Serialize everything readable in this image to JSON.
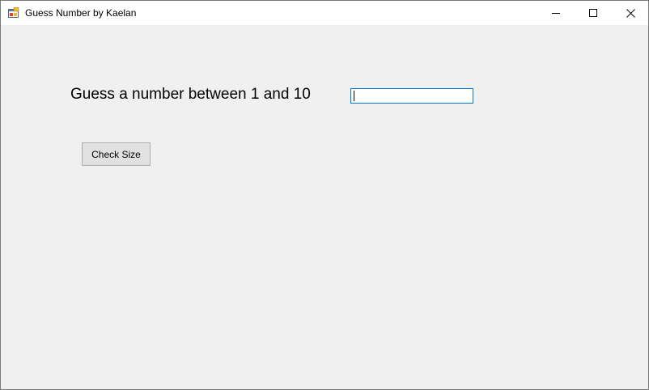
{
  "window": {
    "title": "Guess Number by Kaelan",
    "icon": "winforms-app-icon",
    "controls": {
      "minimize_icon": "minimize-icon",
      "maximize_icon": "maximize-icon",
      "close_icon": "close-icon"
    }
  },
  "form": {
    "prompt": "Guess a number between 1 and 10",
    "guess_input": {
      "value": "",
      "placeholder": ""
    },
    "check_button_label": "Check Size"
  },
  "colors": {
    "titlebar_bg": "#ffffff",
    "client_bg": "#f0f0f0",
    "input_focus_border": "#0078d7",
    "button_bg": "#e1e1e1",
    "button_border": "#adadad"
  }
}
